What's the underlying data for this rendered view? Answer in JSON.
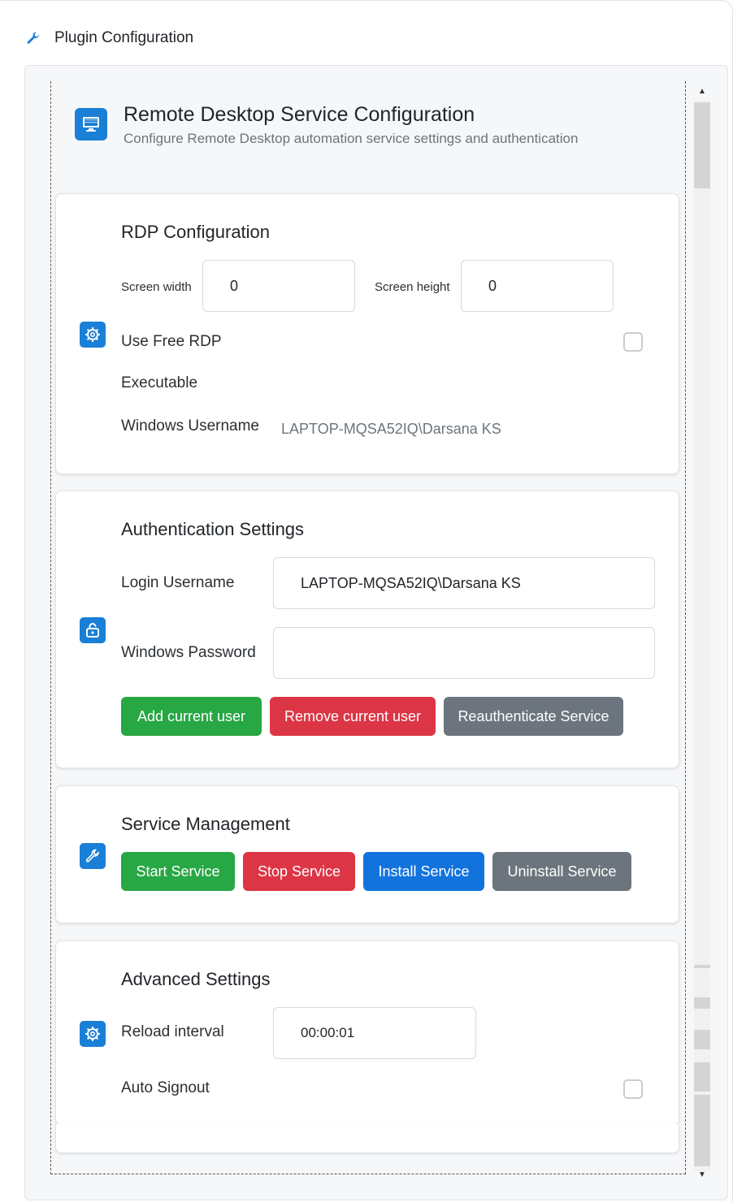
{
  "header": {
    "title": "Plugin Configuration",
    "icon": "wrench-icon"
  },
  "service": {
    "title": "Remote Desktop Service Configuration",
    "subtitle": "Configure Remote Desktop automation service settings and authentication",
    "icon": "monitor-icon"
  },
  "rdp": {
    "title": "RDP Configuration",
    "icon": "gear-icon",
    "screen_width_label": "Screen width",
    "screen_width_value": "0",
    "screen_height_label": "Screen height",
    "screen_height_value": "0",
    "use_free_rdp_label": "Use Free RDP",
    "use_free_rdp_checked": false,
    "executable_label": "Executable",
    "windows_username_label": "Windows Username",
    "windows_username_value": "LAPTOP-MQSA52IQ\\Darsana KS"
  },
  "auth": {
    "title": "Authentication Settings",
    "icon": "lock-icon",
    "login_username_label": "Login Username",
    "login_username_value": "LAPTOP-MQSA52IQ\\Darsana KS",
    "windows_password_label": "Windows Password",
    "windows_password_value": "",
    "add_user": "Add current user",
    "remove_user": "Remove current user",
    "reauth": "Reauthenticate Service"
  },
  "service_mgmt": {
    "title": "Service Management",
    "icon": "wrench-icon",
    "start": "Start Service",
    "stop": "Stop Service",
    "install": "Install Service",
    "uninstall": "Uninstall Service"
  },
  "advanced": {
    "title": "Advanced Settings",
    "icon": "gear-icon",
    "reload_interval_label": "Reload interval",
    "reload_interval_value": "00:00:01",
    "auto_signout_label": "Auto Signout",
    "auto_signout_checked": false
  },
  "colors": {
    "accent": "#1a7fd6",
    "success": "#28a745",
    "danger": "#dc3545",
    "secondary": "#6c757d",
    "primary": "#1273dd"
  }
}
